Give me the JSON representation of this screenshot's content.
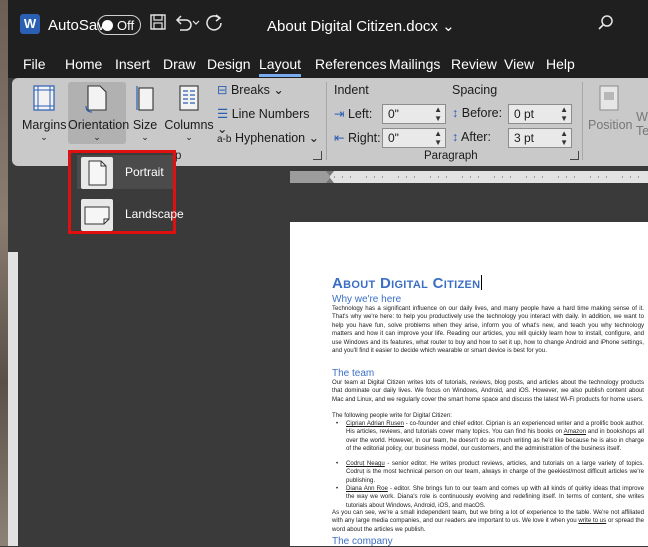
{
  "titlebar": {
    "app_logo": "W",
    "autosave_label": "AutoSave",
    "autosave_state": "Off",
    "document_title": "About Digital Citizen.docx",
    "title_chevron": "⌄",
    "icons": [
      "save-icon",
      "undo-icon",
      "redo-icon",
      "search-icon"
    ]
  },
  "menu": {
    "tabs": [
      "File",
      "Home",
      "Insert",
      "Draw",
      "Design",
      "Layout",
      "References",
      "Mailings",
      "Review",
      "View",
      "Help"
    ],
    "active_tab": "Layout"
  },
  "ribbon": {
    "margins": "Margins",
    "orientation": "Orientation",
    "size": "Size",
    "columns": "Columns",
    "breaks": "Breaks",
    "line_numbers": "Line Numbers",
    "hyphenation": "Hyphenation",
    "page_setup_fragment": "p",
    "indent_header": "Indent",
    "indent_left_label": "Left:",
    "indent_left_value": "0\"",
    "indent_right_label": "Right:",
    "indent_right_value": "0\"",
    "spacing_header": "Spacing",
    "spacing_before_label": "Before:",
    "spacing_before_value": "0 pt",
    "spacing_after_label": "After:",
    "spacing_after_value": "3 pt",
    "paragraph_group_label": "Paragraph",
    "position": "Position",
    "wrap_fragment": "W",
    "wrap_fragment2": "Te"
  },
  "orientation_menu": {
    "items": [
      "Portrait",
      "Landscape"
    ],
    "highlighted": "Portrait"
  },
  "document": {
    "title": "About Digital Citizen",
    "h_why": "Why we're here",
    "p_why": "Technology has a significant influence on our daily lives, and many people have a hard time making sense of it. That's why we're here: to help you productively use the technology you interact with daily. In addition, we want to help you have fun, solve problems when they arise, inform you of what's new, and teach you why technology matters and how it can improve your life. Reading our articles, you will quickly learn how to install, configure, and use Windows and its features, what router to buy and how to set it up, how to change Android and iPhone settings, and you'll find it easier to decide which wearable or smart device is best for you.",
    "h_team": "The team",
    "p_team": "Our team at Digital Citizen writes lots of tutorials, reviews, blog posts, and articles about the technology products that dominate our daily lives. We focus on Windows, Android, and iOS. However, we also publish content about Mac and Linux, and we regularly cover the smart home space and discuss the latest Wi-Fi products for home users.",
    "p_people": "The following people write for Digital Citizen:",
    "b1_name": "Ciprian Adrian Rusen",
    "b1_text": " - co-founder and chief editor. Ciprian is an experienced writer and a prolific book author. His articles, reviews, and tutorials cover many topics. You can find his books on ",
    "b1_link": "Amazon",
    "b1_rest": " and in bookshops all over the world. However, in our team, he doesn't do as much writing as he'd like because he is also in charge of the editorial policy, our business model, our customers, and the administration of the business itself.",
    "b2_name": "Codruț Neagu",
    "b2_text": " - senior editor. He writes product reviews, articles, and tutorials on a large variety of topics. Codruț is the most technical person on our team, always in charge of the geekiest/most difficult articles we're publishing.",
    "b3_name": "Diana Ann Roe",
    "b3_text": " - editor. She brings fun to our team and comes up with all kinds of quirky ideas that improve the way we work. Diana's role is continuously evolving and redefining itself. In terms of content, she writes tutorials about Windows, Android, iOS, and macOS.",
    "p_small": "As you can see, we're a small independent team, but we bring a lot of experience to the table. We're not affiliated with any large media companies, and our readers are important to us. We love it when you ",
    "p_small_link": "write to us",
    "p_small_rest": " or spread the word about the articles we publish.",
    "h_company": "The company"
  },
  "colors": {
    "accent": "#3b6fc4",
    "highlight_border": "#e01010",
    "ribbon_bg": "#c9c9c9",
    "titlebar_bg": "#1f1f1f"
  }
}
